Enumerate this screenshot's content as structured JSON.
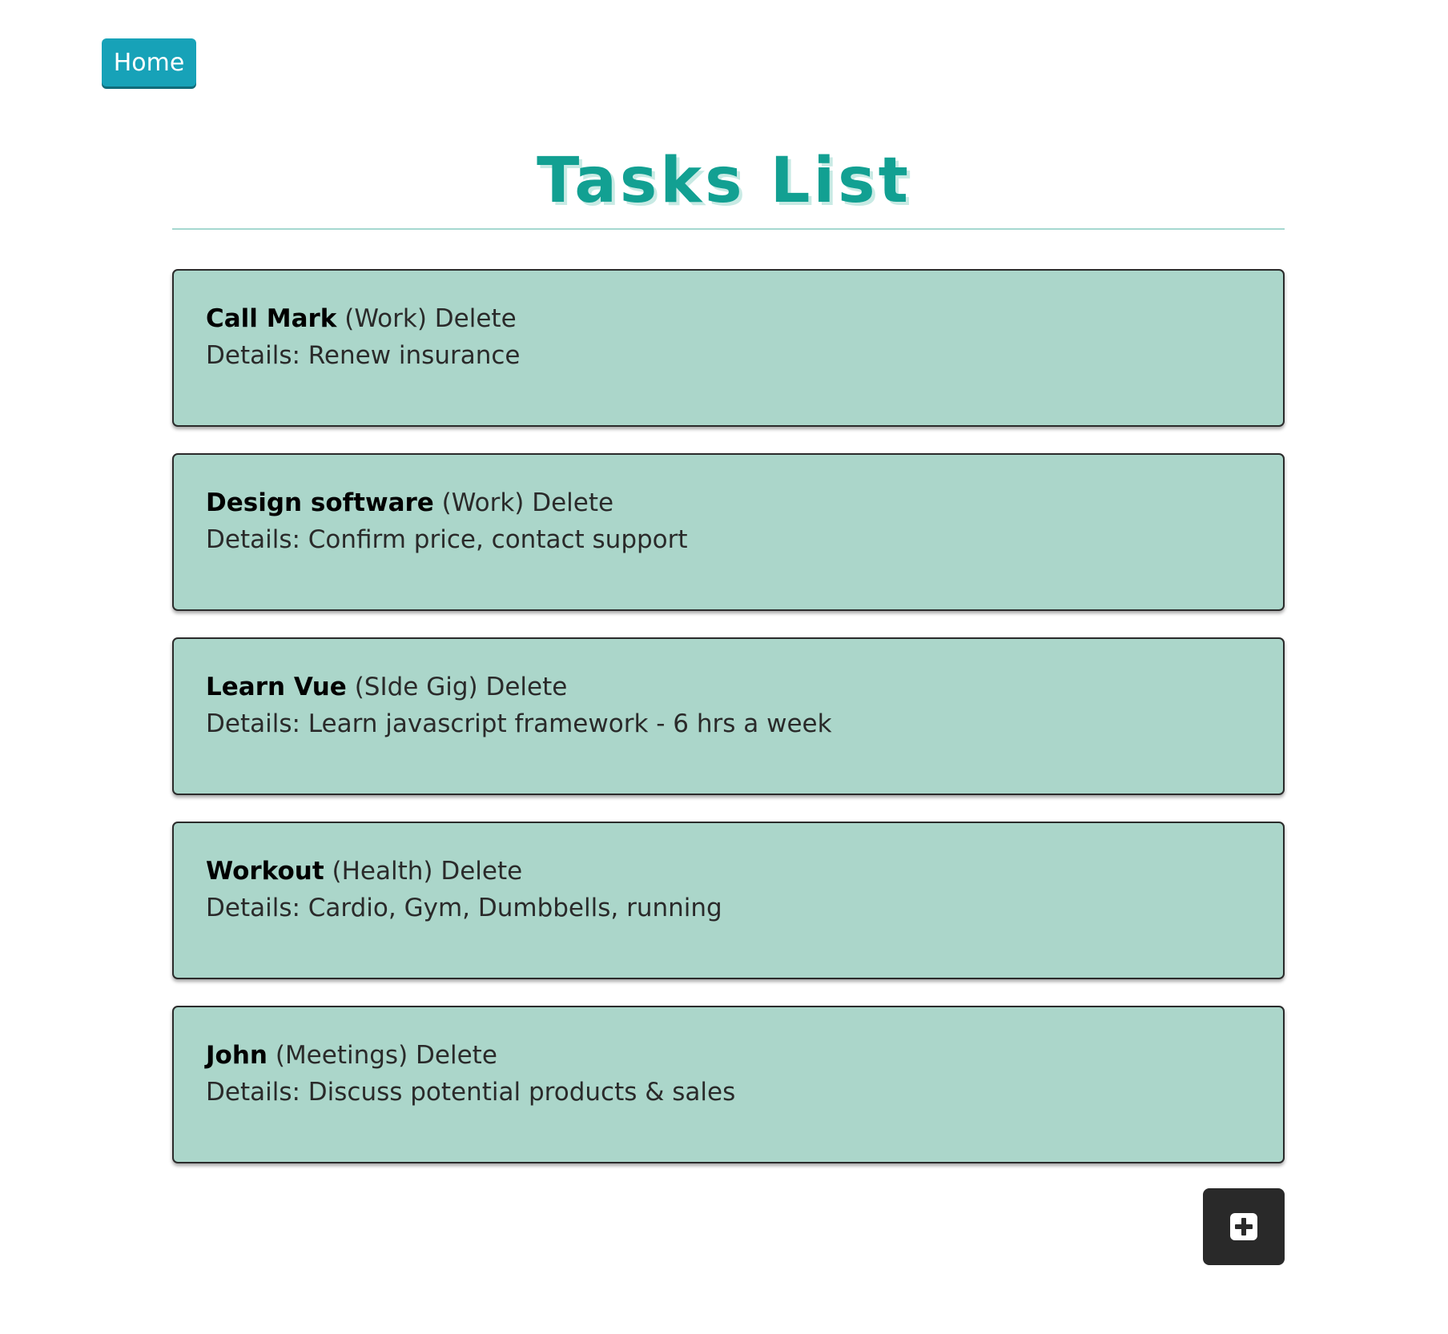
{
  "nav": {
    "home_label": "Home"
  },
  "page": {
    "title": "Tasks List"
  },
  "tasks": [
    {
      "name": "Call Mark",
      "category": "(Work)",
      "delete_label": "Delete",
      "details": "Details: Renew insurance"
    },
    {
      "name": "Design software",
      "category": "(Work)",
      "delete_label": "Delete",
      "details": "Details: Confirm price, contact support"
    },
    {
      "name": "Learn Vue",
      "category": "(SIde Gig)",
      "delete_label": "Delete",
      "details": "Details: Learn javascript framework - 6 hrs a week"
    },
    {
      "name": "Workout",
      "category": "(Health)",
      "delete_label": "Delete",
      "details": "Details: Cardio, Gym, Dumbbells, running"
    },
    {
      "name": "John",
      "category": "(Meetings)",
      "delete_label": "Delete",
      "details": "Details: Discuss potential products & sales"
    }
  ],
  "add_button": {
    "icon": "plus-square-icon"
  },
  "colors": {
    "home_button": "#17a2b8",
    "title": "#12a092",
    "card_background": "#abd6ca",
    "add_button": "#292929"
  }
}
